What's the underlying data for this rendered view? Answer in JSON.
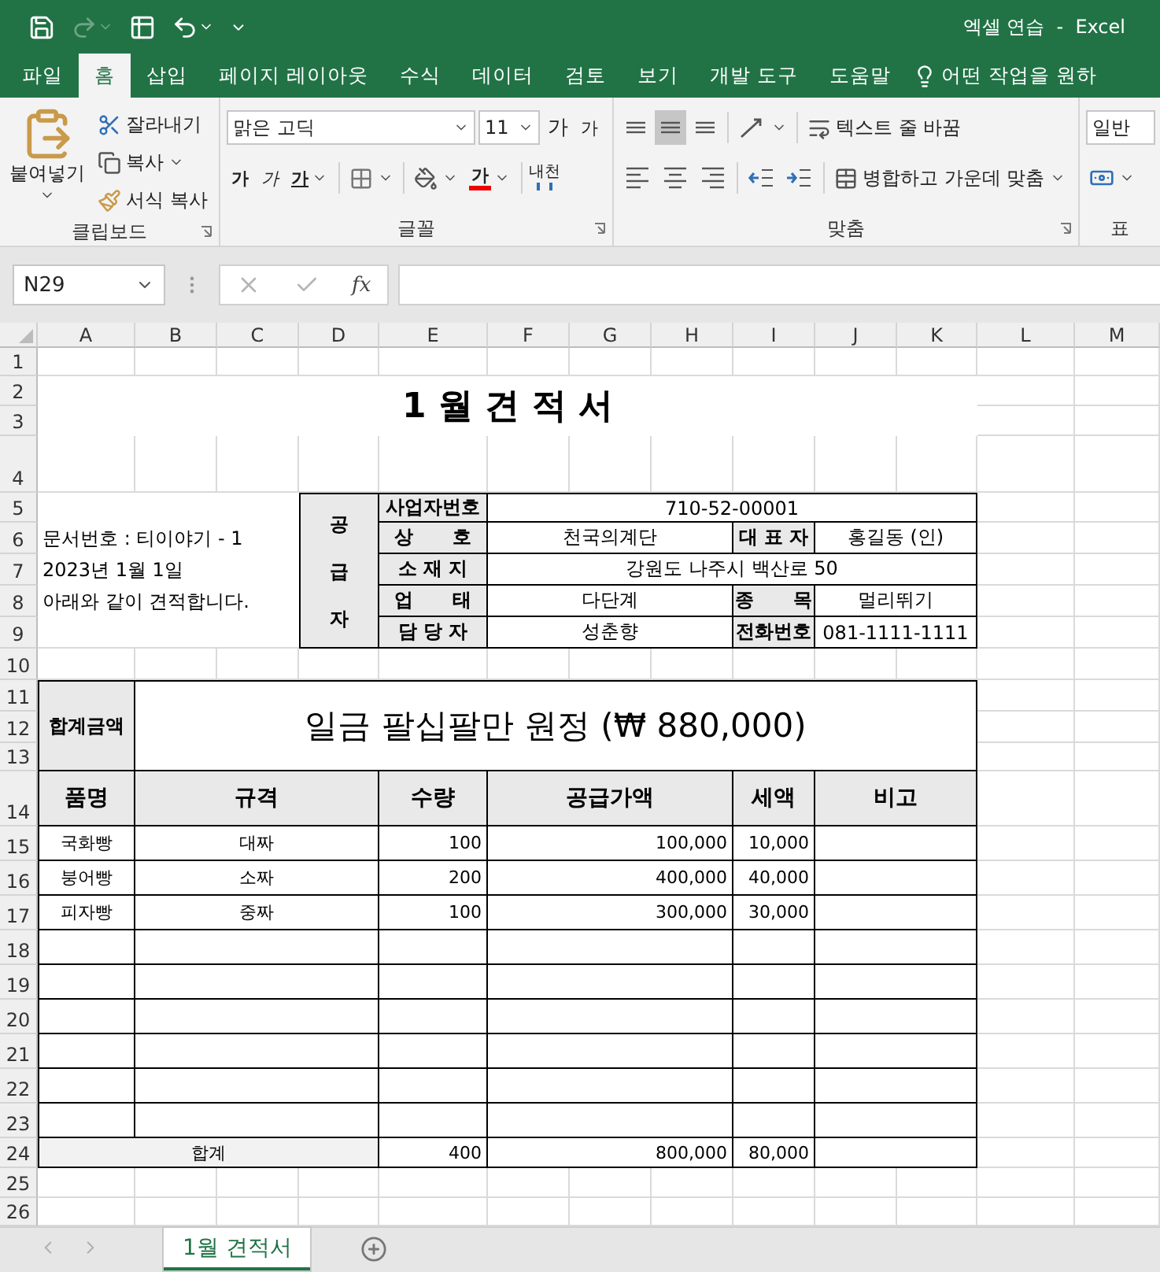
{
  "window": {
    "title": "엑셀 연습  -  Excel"
  },
  "quick_access": [
    {
      "kind": "save",
      "disabled": false
    },
    {
      "kind": "redo",
      "disabled": true
    },
    {
      "kind": "form",
      "disabled": false
    },
    {
      "kind": "undo",
      "disabled": false
    }
  ],
  "ribbon_tabs": [
    {
      "label": "파일",
      "selected": false
    },
    {
      "label": "홈",
      "selected": true
    },
    {
      "label": "삽입",
      "selected": false
    },
    {
      "label": "페이지 레이아웃",
      "selected": false
    },
    {
      "label": "수식",
      "selected": false
    },
    {
      "label": "데이터",
      "selected": false
    },
    {
      "label": "검토",
      "selected": false
    },
    {
      "label": "보기",
      "selected": false
    },
    {
      "label": "개발 도구",
      "selected": false
    },
    {
      "label": "도움말",
      "selected": false
    }
  ],
  "tell_me": "어떤 작업을 원하",
  "ribbon": {
    "clipboard": {
      "paste": "붙여넣기",
      "cut": "잘라내기",
      "copy": "복사",
      "format_painter": "서식 복사",
      "label": "클립보드"
    },
    "font": {
      "font_name": "맑은 고딕",
      "font_size": "11",
      "grow": "가",
      "shrink": "가",
      "bold": "가",
      "italic": "가",
      "underline": "가",
      "font_color": "가",
      "phonetic": "내천",
      "label": "글꼴"
    },
    "alignment": {
      "vertical": [
        {
          "selected": false
        },
        {
          "selected": true
        },
        {
          "selected": false
        }
      ],
      "wrap_text": "텍스트 줄 바꿈",
      "merge": "병합하고 가운데 맞춤",
      "label": "맞춤"
    },
    "number": {
      "format": "일반",
      "label": "표"
    }
  },
  "formula_bar": {
    "name_box": "N29",
    "buttons": [
      {
        "kind": "cancel",
        "disabled": true
      },
      {
        "kind": "enter",
        "disabled": true
      }
    ],
    "function_label": "fx"
  },
  "columns": [
    "A",
    "B",
    "C",
    "D",
    "E",
    "F",
    "G",
    "H",
    "I",
    "J",
    "K",
    "L",
    "M"
  ],
  "rows": [
    "1",
    "2",
    "3",
    "4",
    "5",
    "6",
    "7",
    "8",
    "9",
    "10",
    "11",
    "12",
    "13",
    "14",
    "15",
    "16",
    "17",
    "18",
    "19",
    "20",
    "21",
    "22",
    "23",
    "24",
    "25",
    "26"
  ],
  "sheet": {
    "title": "1 월 견 적 서",
    "notes": [
      "문서번호 : 티이야기 - 1",
      "2023년 1월 1일",
      "아래와 같이 견적합니다."
    ],
    "supplier": {
      "label": "공급자",
      "rows": [
        {
          "kind": "full",
          "fields": [
            {
              "label": "사업자번호",
              "value": "710-52-00001"
            }
          ]
        },
        {
          "kind": "split",
          "fields": [
            {
              "label": "상      호",
              "value": "천국의계단"
            },
            {
              "label": "대 표 자",
              "value": "홍길동 (인)"
            }
          ]
        },
        {
          "kind": "full",
          "fields": [
            {
              "label": "소 재 지",
              "value": "강원도 나주시 백산로 50"
            }
          ]
        },
        {
          "kind": "split",
          "fields": [
            {
              "label": "업      태",
              "value": "다단계"
            },
            {
              "label": "종      목",
              "value": "멀리뛰기"
            }
          ]
        },
        {
          "kind": "split",
          "fields": [
            {
              "label": "담 당 자",
              "value": "성춘향"
            },
            {
              "label": "전화번호",
              "value": "081-1111-1111"
            }
          ]
        }
      ]
    },
    "amount": {
      "label": "합계금액",
      "value": "일금 팔십팔만 원정 (₩ 880,000)"
    },
    "items": {
      "header": [
        "품명",
        "규격",
        "수량",
        "공급가액",
        "세액",
        "비고"
      ],
      "rows": [
        {
          "name": "국화빵",
          "spec": "대짜",
          "qty": "100",
          "supply": "100,000",
          "tax": "10,000"
        },
        {
          "name": "붕어빵",
          "spec": "소짜",
          "qty": "200",
          "supply": "400,000",
          "tax": "40,000"
        },
        {
          "name": "피자빵",
          "spec": "중짜",
          "qty": "100",
          "supply": "300,000",
          "tax": "30,000"
        },
        {},
        {},
        {},
        {},
        {},
        {}
      ],
      "total": {
        "label": "합계",
        "qty": "400",
        "supply": "800,000",
        "tax": "80,000"
      }
    }
  },
  "sheet_tabs": [
    {
      "label": "1월 견적서",
      "selected": true
    }
  ]
}
